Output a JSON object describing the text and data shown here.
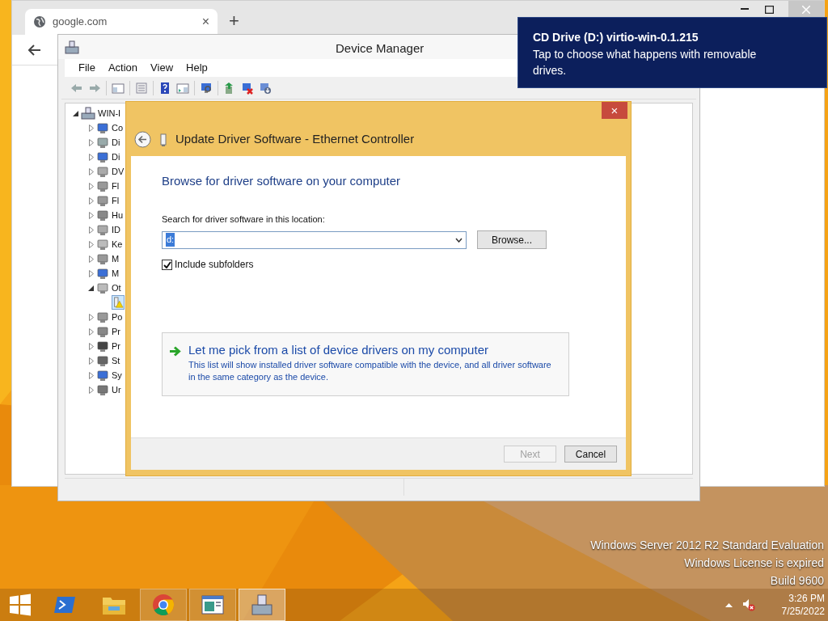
{
  "browser": {
    "tab": {
      "title": "google.com",
      "close": "×"
    },
    "new_tab": "+"
  },
  "device_manager": {
    "title": "Device Manager",
    "menu": [
      "File",
      "Action",
      "View",
      "Help"
    ],
    "tree": {
      "label": "WIN-I",
      "expanded": true,
      "children": [
        {
          "label": "Co",
          "expanded": false
        },
        {
          "label": "Di",
          "expanded": false
        },
        {
          "label": "Di",
          "expanded": false
        },
        {
          "label": "DV",
          "expanded": false
        },
        {
          "label": "Fl",
          "expanded": false
        },
        {
          "label": "Fl",
          "expanded": false
        },
        {
          "label": "Hu",
          "expanded": false
        },
        {
          "label": "ID",
          "expanded": false
        },
        {
          "label": "Ke",
          "expanded": false
        },
        {
          "label": "M",
          "expanded": false
        },
        {
          "label": "M",
          "expanded": false
        },
        {
          "label": "Ot",
          "expanded": true,
          "children": [
            {
              "selected": true
            }
          ]
        },
        {
          "label": "Po",
          "expanded": false
        },
        {
          "label": "Pr",
          "expanded": false
        },
        {
          "label": "Pr",
          "expanded": false
        },
        {
          "label": "St",
          "expanded": false
        },
        {
          "label": "Sy",
          "expanded": false
        },
        {
          "label": "Ur",
          "expanded": false
        }
      ]
    }
  },
  "dialog": {
    "title": "Update Driver Software - Ethernet Controller",
    "close": "×",
    "heading": "Browse for driver software on your computer",
    "location_label": "Search for driver software in this location:",
    "location_value": "d:",
    "browse_button": "Browse...",
    "include_subfolders": {
      "label": "Include subfolders",
      "checked": true
    },
    "pick_option": {
      "title": "Let me pick from a list of device drivers on my computer",
      "description": "This list will show installed driver software compatible with the device, and all driver software in the same category as the device."
    },
    "buttons": [
      {
        "label": "Next",
        "disabled": true
      },
      {
        "label": "Cancel",
        "disabled": false
      }
    ]
  },
  "notification": {
    "title": "CD Drive (D:) virtio-win-0.1.215",
    "message": "Tap to choose what happens with removable drives."
  },
  "desktop_notice": [
    "Windows Server 2012 R2 Standard Evaluation",
    "Windows License is expired",
    "Build 9600"
  ],
  "taskbar": {
    "apps": [
      {
        "kind": "powershell",
        "running": false,
        "selected": false
      },
      {
        "kind": "explorer",
        "running": false,
        "selected": false
      },
      {
        "kind": "chrome",
        "running": true,
        "selected": false
      },
      {
        "kind": "window",
        "running": true,
        "selected": false
      },
      {
        "kind": "devmgr",
        "running": true,
        "selected": true
      }
    ],
    "clock": {
      "time": "3:26 PM",
      "date": "7/25/2022"
    }
  }
}
